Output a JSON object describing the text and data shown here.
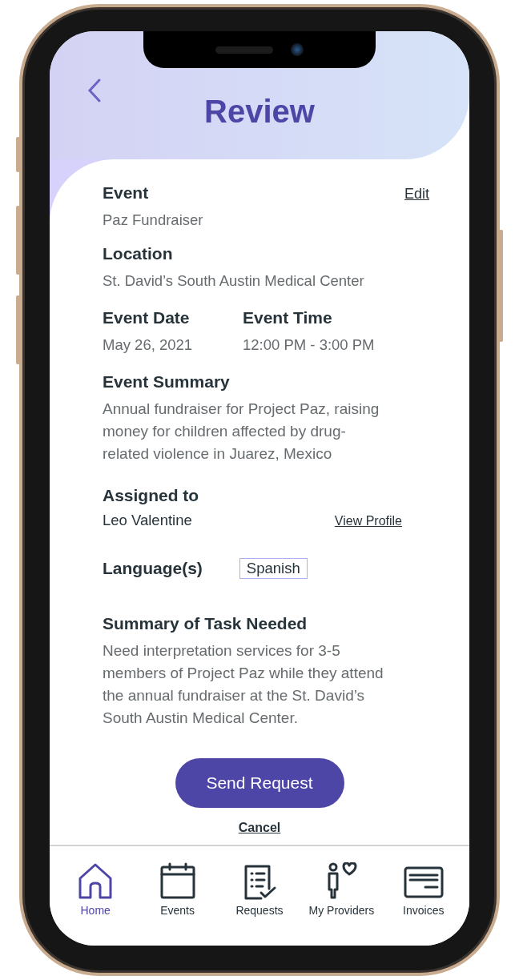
{
  "header": {
    "title": "Review"
  },
  "event": {
    "label": "Event",
    "value": "Paz Fundraiser",
    "edit": "Edit"
  },
  "location": {
    "label": "Location",
    "value": "St. David’s South Austin Medical Center"
  },
  "schedule": [
    {
      "label": "Event Date",
      "value": "May 26, 2021"
    },
    {
      "label": "Event Time",
      "value": "12:00 PM - 3:00 PM"
    }
  ],
  "summary": {
    "label": "Event Summary",
    "text": "Annual fundraiser for Project Paz, raising money for children affected by drug-related violence in Juarez, Mexico"
  },
  "assigned": {
    "label": "Assigned to",
    "name": "Leo Valentine",
    "link": "View Profile"
  },
  "languages": {
    "label": "Language(s)",
    "tags": [
      "Spanish"
    ]
  },
  "task": {
    "label": "Summary of Task Needed",
    "text": "Need interpretation services for 3-5 members of Project Paz while they attend the annual fundraiser at the St. David’s South Austin Medical Center."
  },
  "actions": {
    "primary": "Send Request",
    "secondary": "Cancel"
  },
  "nav": [
    {
      "label": "Home",
      "kind": "home",
      "selected": true
    },
    {
      "label": "Events",
      "kind": "calendar",
      "selected": false
    },
    {
      "label": "Requests",
      "kind": "checklist",
      "selected": false
    },
    {
      "label": "My Providers",
      "kind": "providers",
      "selected": false
    },
    {
      "label": "Invoices",
      "kind": "invoice",
      "selected": false
    }
  ]
}
